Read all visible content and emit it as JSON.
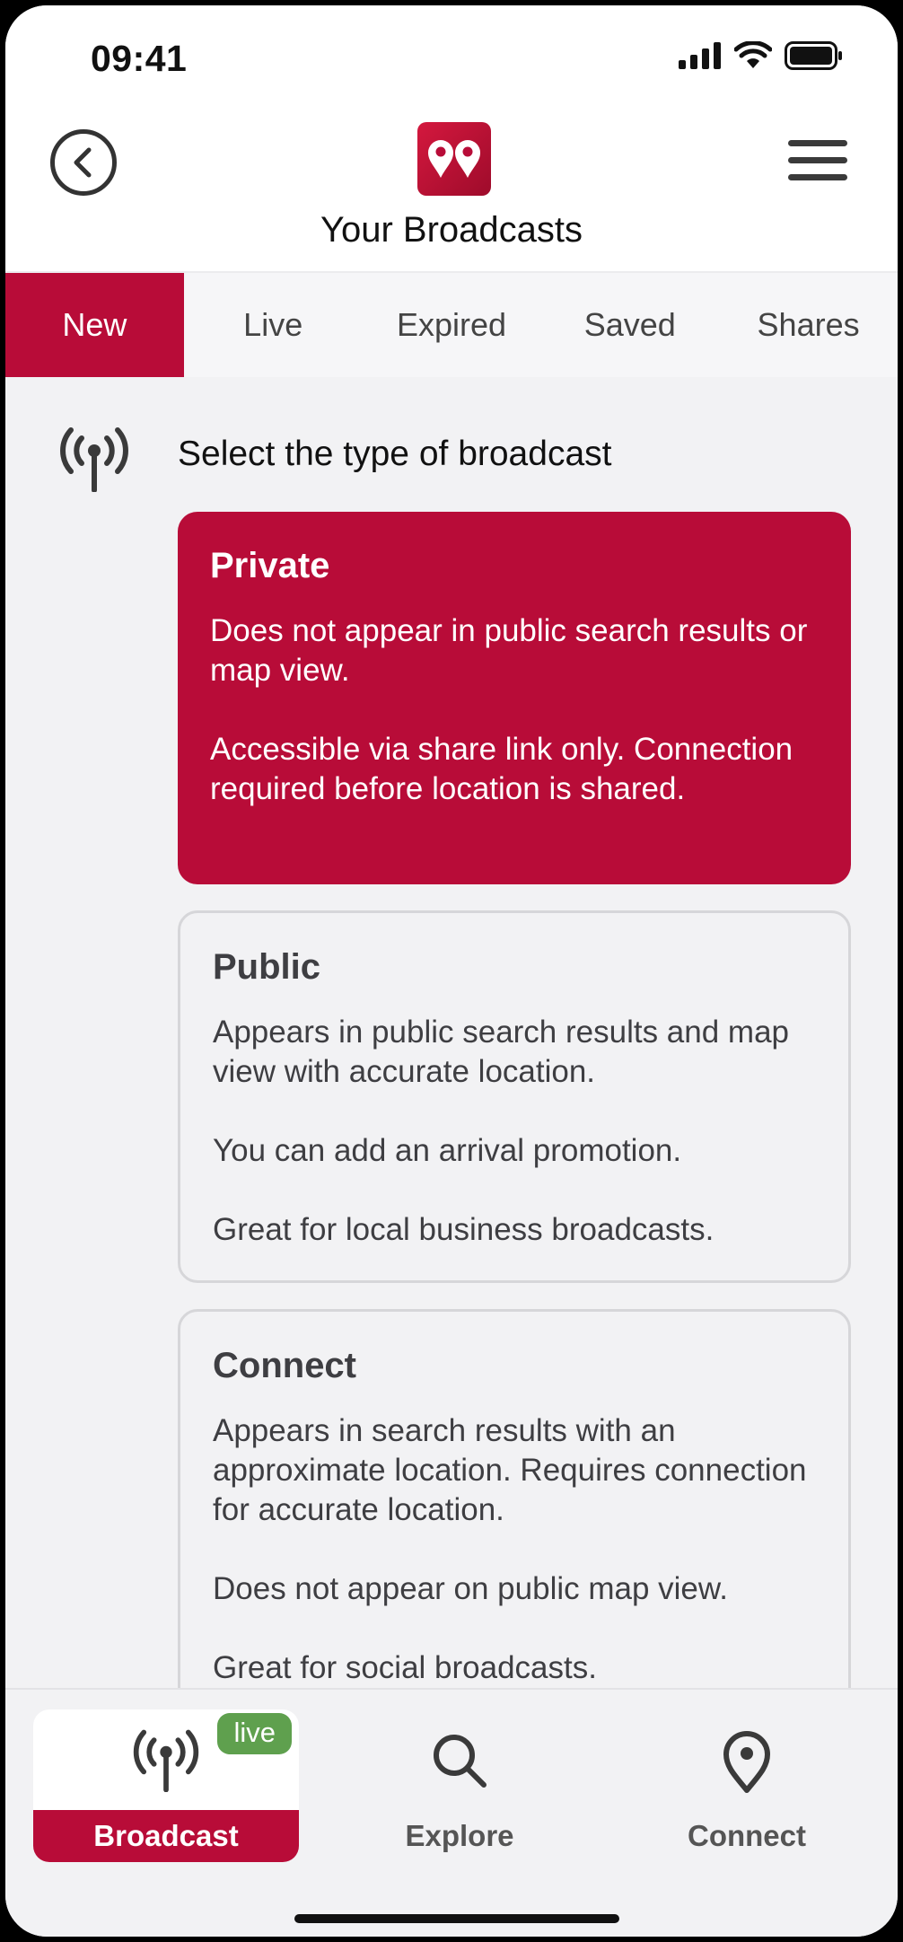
{
  "status_bar": {
    "time": "09:41"
  },
  "header": {
    "title": "Your Broadcasts"
  },
  "tabs": [
    {
      "label": "New",
      "active": true
    },
    {
      "label": "Live",
      "active": false
    },
    {
      "label": "Expired",
      "active": false
    },
    {
      "label": "Saved",
      "active": false
    },
    {
      "label": "Shares",
      "active": false
    }
  ],
  "section": {
    "title": "Select the type of broadcast",
    "icon": "broadcast-icon"
  },
  "cards": [
    {
      "title": "Private",
      "selected": true,
      "paragraphs": [
        "Does not appear in public search results or map view.",
        "Accessible via share link only. Connection required before location is shared."
      ]
    },
    {
      "title": "Public",
      "selected": false,
      "paragraphs": [
        "Appears in public search results and map view with accurate location.",
        "You can add an arrival promotion.",
        "Great for local business broadcasts."
      ]
    },
    {
      "title": "Connect",
      "selected": false,
      "paragraphs": [
        "Appears in search results with an approximate location. Requires connection for accurate location.",
        "Does not appear on public map view.",
        "Great for social broadcasts."
      ]
    }
  ],
  "tabbar": {
    "items": [
      {
        "label": "Broadcast",
        "icon": "broadcast-icon",
        "badge": "live",
        "active": true
      },
      {
        "label": "Explore",
        "icon": "search-icon",
        "active": false
      },
      {
        "label": "Connect",
        "icon": "location-pin-icon",
        "active": false
      }
    ]
  },
  "colors": {
    "accent": "#b80c38",
    "badge": "#5fa04e"
  }
}
